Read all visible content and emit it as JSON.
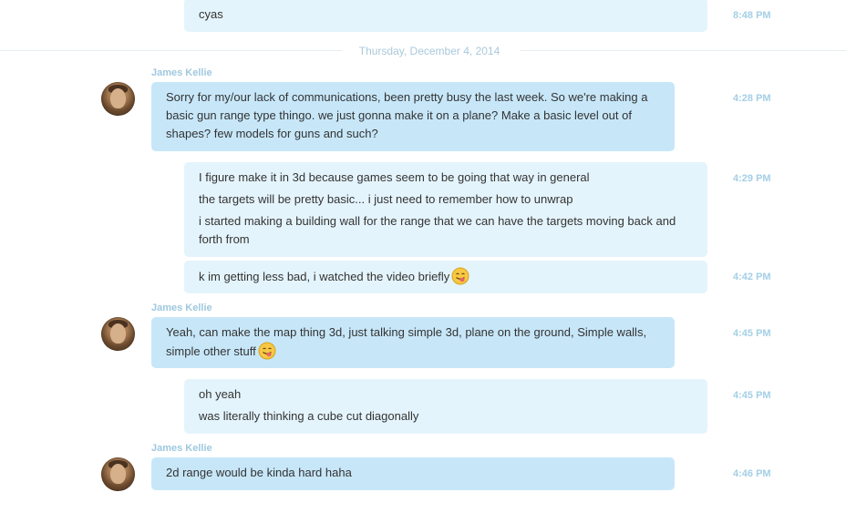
{
  "date_divider": "Thursday, December 4, 2014",
  "messages": [
    {
      "sender": "",
      "direction": "outgoing",
      "lines": [
        "cyas"
      ],
      "time": "8:48 PM"
    },
    {
      "sender": "James Kellie",
      "direction": "incoming",
      "lines": [
        "Sorry for my/our lack of communications, been pretty busy the last week. So we're making a basic gun range type thingo. we just gonna make it on a plane? Make a basic level out of shapes? few models for guns and such?"
      ],
      "time": "4:28 PM"
    },
    {
      "sender": "",
      "direction": "outgoing",
      "lines": [
        "I figure make it in 3d because games seem to be going that way in general",
        "the targets will be pretty basic... i just need to remember how to unwrap",
        "i started making a building wall for the range that we can have the targets moving back and forth from"
      ],
      "time": "4:29 PM"
    },
    {
      "sender": "",
      "direction": "outgoing",
      "lines": [
        "k im getting less bad, i watched the video briefly"
      ],
      "emoji": "tongue-out-emoji",
      "time": "4:42 PM"
    },
    {
      "sender": "James Kellie",
      "direction": "incoming",
      "lines": [
        "Yeah, can make the map thing 3d, just talking simple 3d, plane on the ground, Simple walls, simple other stuff"
      ],
      "emoji": "tongue-out-emoji",
      "time": "4:45 PM"
    },
    {
      "sender": "",
      "direction": "outgoing",
      "lines": [
        "oh yeah",
        "was literally thinking a cube cut diagonally"
      ],
      "time": "4:45 PM"
    },
    {
      "sender": "James Kellie",
      "direction": "incoming",
      "lines": [
        "2d range would be kinda hard haha"
      ],
      "time": "4:46 PM"
    }
  ],
  "colors": {
    "incoming_bubble": "#c7e7f9",
    "outgoing_bubble": "#e4f4fc",
    "timestamp": "#a4cfe6",
    "sender_name": "#9ec8df"
  }
}
